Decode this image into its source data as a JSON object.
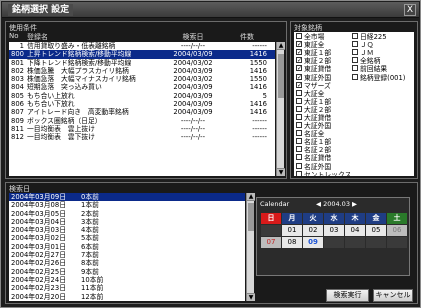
{
  "window": {
    "title": "銘柄選択 設定",
    "close_glyph": "X"
  },
  "conditions": {
    "panel_label": "使用条件",
    "columns": {
      "no": "No",
      "name": "登録名",
      "date": "検索日",
      "count": "件数"
    },
    "rows": [
      {
        "no": "1",
        "name": "信用貸取り盛み・低表離銘柄",
        "date": "----/--/--",
        "count": "------"
      },
      {
        "no": "800",
        "name": "上昇トレンド銘柄検索/移動平均線",
        "date": "2004/03/09",
        "count": "1416"
      },
      {
        "no": "801",
        "name": "下降トレンド銘柄検索/移動平均線",
        "date": "2004/03/02",
        "count": "1550"
      },
      {
        "no": "802",
        "name": "株価急騰　大幅プラスカイリ銘柄",
        "date": "2004/03/09",
        "count": "1416"
      },
      {
        "no": "803",
        "name": "株価急落　大幅マイナスカイリ銘柄",
        "date": "2004/03/02",
        "count": "1550"
      },
      {
        "no": "804",
        "name": "短期急落　突っ込み買い",
        "date": "2004/03/09",
        "count": "1416"
      },
      {
        "no": "805",
        "name": "もち合い上放れ",
        "date": "2004/03/09",
        "count": "5"
      },
      {
        "no": "806",
        "name": "もち合い下放れ",
        "date": "2004/03/09",
        "count": "1416"
      },
      {
        "no": "807",
        "name": "アイトレード向き　高変動率銘柄",
        "date": "2004/03/09",
        "count": "1416"
      },
      {
        "no": "809",
        "name": "ボックス圏銘柄（日足）",
        "date": "----/--/--",
        "count": "------"
      },
      {
        "no": "811",
        "name": "一目均衡表　雲上抜け",
        "date": "----/--/--",
        "count": "------"
      },
      {
        "no": "812",
        "name": "一目均衡表　雲下抜け",
        "date": "----/--/--",
        "count": "------"
      },
      {
        "no": "",
        "name": "",
        "date": "",
        "count": ""
      },
      {
        "no": "",
        "name": "",
        "date": "",
        "count": ""
      },
      {
        "no": "",
        "name": "",
        "date": "",
        "count": ""
      },
      {
        "no": "",
        "name": "",
        "date": "",
        "count": ""
      }
    ],
    "selected_index": 1
  },
  "markets": {
    "panel_label": "対象銘柄",
    "left": [
      {
        "label": "全市場",
        "checked": false
      },
      {
        "label": "東証全",
        "checked": true
      },
      {
        "label": "東証１部",
        "checked": true
      },
      {
        "label": "東証２部",
        "checked": true
      },
      {
        "label": "東証貸借",
        "checked": true
      },
      {
        "label": "東証外国",
        "checked": true
      },
      {
        "label": "マザーズ",
        "checked": true
      },
      {
        "label": "大証全",
        "checked": false
      },
      {
        "label": "大証１部",
        "checked": false
      },
      {
        "label": "大証２部",
        "checked": false
      },
      {
        "label": "大証貸借",
        "checked": false
      },
      {
        "label": "大証外国",
        "checked": false
      },
      {
        "label": "名証全",
        "checked": false
      },
      {
        "label": "名証１部",
        "checked": false
      },
      {
        "label": "名証２部",
        "checked": false
      },
      {
        "label": "名証貸借",
        "checked": false
      },
      {
        "label": "名証外国",
        "checked": false
      },
      {
        "label": "セントレックス",
        "checked": false
      }
    ],
    "right": [
      {
        "label": "日経225",
        "checked": false
      },
      {
        "label": "ＪＱ",
        "checked": false
      },
      {
        "label": "ＪＭ",
        "checked": false
      },
      {
        "label": "全銘柄",
        "checked": false
      },
      {
        "label": "前回結果",
        "checked": false
      },
      {
        "label": "銘柄登録(001)",
        "checked": false
      }
    ]
  },
  "search_dates": {
    "panel_label": "検索日",
    "rows": [
      {
        "date": "2004年03月09日",
        "ago": "0本前"
      },
      {
        "date": "2004年03月08日",
        "ago": "1本前"
      },
      {
        "date": "2004年03月05日",
        "ago": "2本前"
      },
      {
        "date": "2004年03月04日",
        "ago": "3本前"
      },
      {
        "date": "2004年03月03日",
        "ago": "4本前"
      },
      {
        "date": "2004年03月02日",
        "ago": "5本前"
      },
      {
        "date": "2004年03月01日",
        "ago": "6本前"
      },
      {
        "date": "2004年02月27日",
        "ago": "7本前"
      },
      {
        "date": "2004年02月26日",
        "ago": "8本前"
      },
      {
        "date": "2004年02月25日",
        "ago": "9本前"
      },
      {
        "date": "2004年02月24日",
        "ago": "10本前"
      },
      {
        "date": "2004年02月23日",
        "ago": "11本前"
      },
      {
        "date": "2004年02月20日",
        "ago": "12本前"
      },
      {
        "date": "2004年02月19日",
        "ago": "13本前"
      }
    ],
    "selected_index": 0
  },
  "calendar": {
    "label": "Calendar",
    "month": "2004.03",
    "prev_glyph": "◀",
    "next_glyph": "▶",
    "dows": [
      "日",
      "月",
      "火",
      "水",
      "木",
      "金",
      "土"
    ],
    "days": [
      "",
      "01",
      "02",
      "03",
      "04",
      "05",
      "06",
      "07",
      "08",
      "09",
      "",
      "",
      "",
      ""
    ],
    "today": "09",
    "holiday": "07"
  },
  "buttons": {
    "search": "検索実行",
    "cancel": "キャンセル"
  }
}
